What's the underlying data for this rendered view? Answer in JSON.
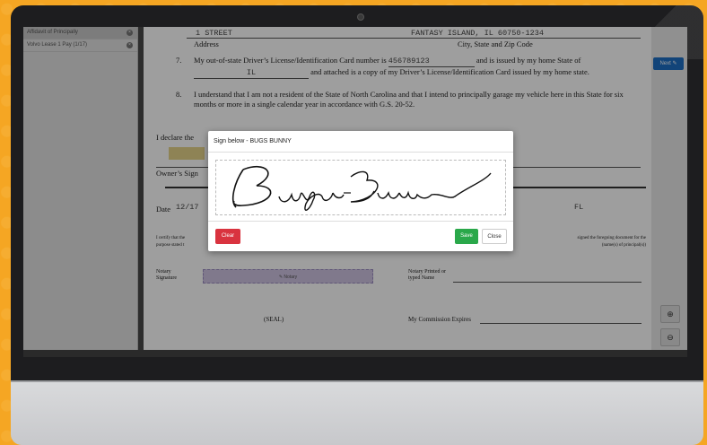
{
  "sidebar": {
    "items": [
      {
        "label": "Affidavit of Principally"
      },
      {
        "label": "Volvo Lease 1 Pay (1/17)"
      }
    ]
  },
  "doc": {
    "street": "1 STREET",
    "city_state_zip": "FANTASY ISLAND, IL 60750-1234",
    "address_label": "Address",
    "csz_label": "City, State and Zip Code",
    "item7_num": "7.",
    "item7_a": "My out-of-state Driver’s License/Identification Card number is",
    "license_no": "456789123",
    "item7_b": "and is issued by my home State of",
    "state": "IL",
    "item7_c": "and attached is a copy of my Driver’s License/Identification Card issued by my home state.",
    "item8_num": "8.",
    "item8": "I understand that I am not a resident of the State of North Carolina and that I intend to principally garage my vehicle here in this State for six months or more in a single calendar year in accordance with G.S. 20-52.",
    "declare": "I declare the",
    "owner_sig": "Owner’s Sign",
    "date_label": "Date",
    "date_val": "12/17",
    "fl": "FL",
    "certify": "I certify that the",
    "purpose": "purpose stated t",
    "certify_right": "signed the foregoing document for the",
    "principal": "(name(s) of principal(s))",
    "notary_sig": "Notary Signature",
    "notary_box": "Notary",
    "notary_printed": "Notary Printed or typed Name",
    "seal": "(SEAL)",
    "commission": "My Commission Expires"
  },
  "modal": {
    "title": "Sign below - BUGS BUNNY",
    "clear": "Clear",
    "save": "Save",
    "close": "Close"
  },
  "nav": {
    "next": "Next",
    "zoom_in": "⊕",
    "zoom_out": "⊖"
  }
}
